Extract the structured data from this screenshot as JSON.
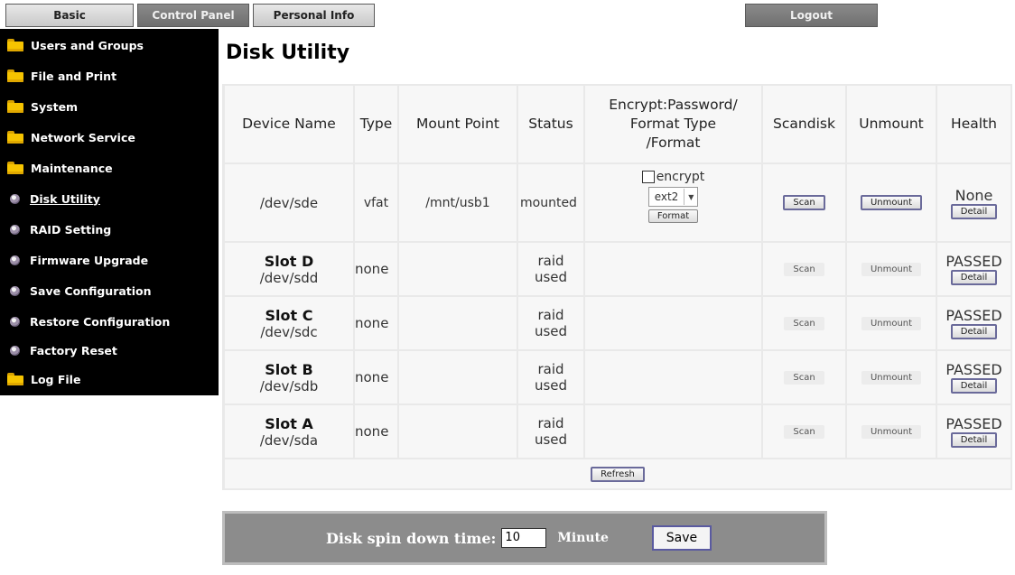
{
  "tabs": {
    "basic": "Basic",
    "control_panel": "Control Panel",
    "personal_info": "Personal Info",
    "logout": "Logout"
  },
  "sidebar": {
    "folders": [
      {
        "label": "Users and Groups",
        "icon": "folder-icon"
      },
      {
        "label": "File and Print",
        "icon": "folder-icon"
      },
      {
        "label": "System",
        "icon": "folder-icon"
      },
      {
        "label": "Network Service",
        "icon": "folder-icon"
      },
      {
        "label": "Maintenance",
        "icon": "folder-icon"
      }
    ],
    "items": [
      {
        "label": "Disk Utility",
        "current": true
      },
      {
        "label": "RAID Setting"
      },
      {
        "label": "Firmware Upgrade"
      },
      {
        "label": "Save Configuration"
      },
      {
        "label": "Restore Configuration"
      },
      {
        "label": "Factory Reset"
      }
    ],
    "log_file": "Log File"
  },
  "page_title": "Disk Utility",
  "table": {
    "headers": {
      "device_name": "Device Name",
      "type": "Type",
      "mount_point": "Mount Point",
      "status": "Status",
      "encrypt_1": "Encrypt:Password/",
      "encrypt_2": "Format Type",
      "encrypt_3": "/Format",
      "scandisk": "Scandisk",
      "unmount": "Unmount",
      "health": "Health"
    },
    "usb_row": {
      "device": "/dev/sde",
      "type": "vfat",
      "mount_point": "/mnt/usb1",
      "status": "mounted",
      "encrypt_label": "encrypt",
      "format_type": "ext2",
      "format_button": "Format",
      "scan_button": "Scan",
      "unmount_button": "Unmount",
      "health": "None",
      "detail_button": "Detail"
    },
    "slot_rows": [
      {
        "slot": "Slot D",
        "device": "/dev/sdd",
        "type": "none",
        "status_1": "raid",
        "status_2": "used",
        "scan": "Scan",
        "unmount": "Unmount",
        "health": "PASSED",
        "detail": "Detail"
      },
      {
        "slot": "Slot C",
        "device": "/dev/sdc",
        "type": "none",
        "status_1": "raid",
        "status_2": "used",
        "scan": "Scan",
        "unmount": "Unmount",
        "health": "PASSED",
        "detail": "Detail"
      },
      {
        "slot": "Slot B",
        "device": "/dev/sdb",
        "type": "none",
        "status_1": "raid",
        "status_2": "used",
        "scan": "Scan",
        "unmount": "Unmount",
        "health": "PASSED",
        "detail": "Detail"
      },
      {
        "slot": "Slot A",
        "device": "/dev/sda",
        "type": "none",
        "status_1": "raid",
        "status_2": "used",
        "scan": "Scan",
        "unmount": "Unmount",
        "health": "PASSED",
        "detail": "Detail"
      }
    ],
    "refresh_button": "Refresh"
  },
  "spin_down": {
    "label": "Disk spin down time:",
    "value": "10",
    "unit": "Minute",
    "save_button": "Save"
  }
}
